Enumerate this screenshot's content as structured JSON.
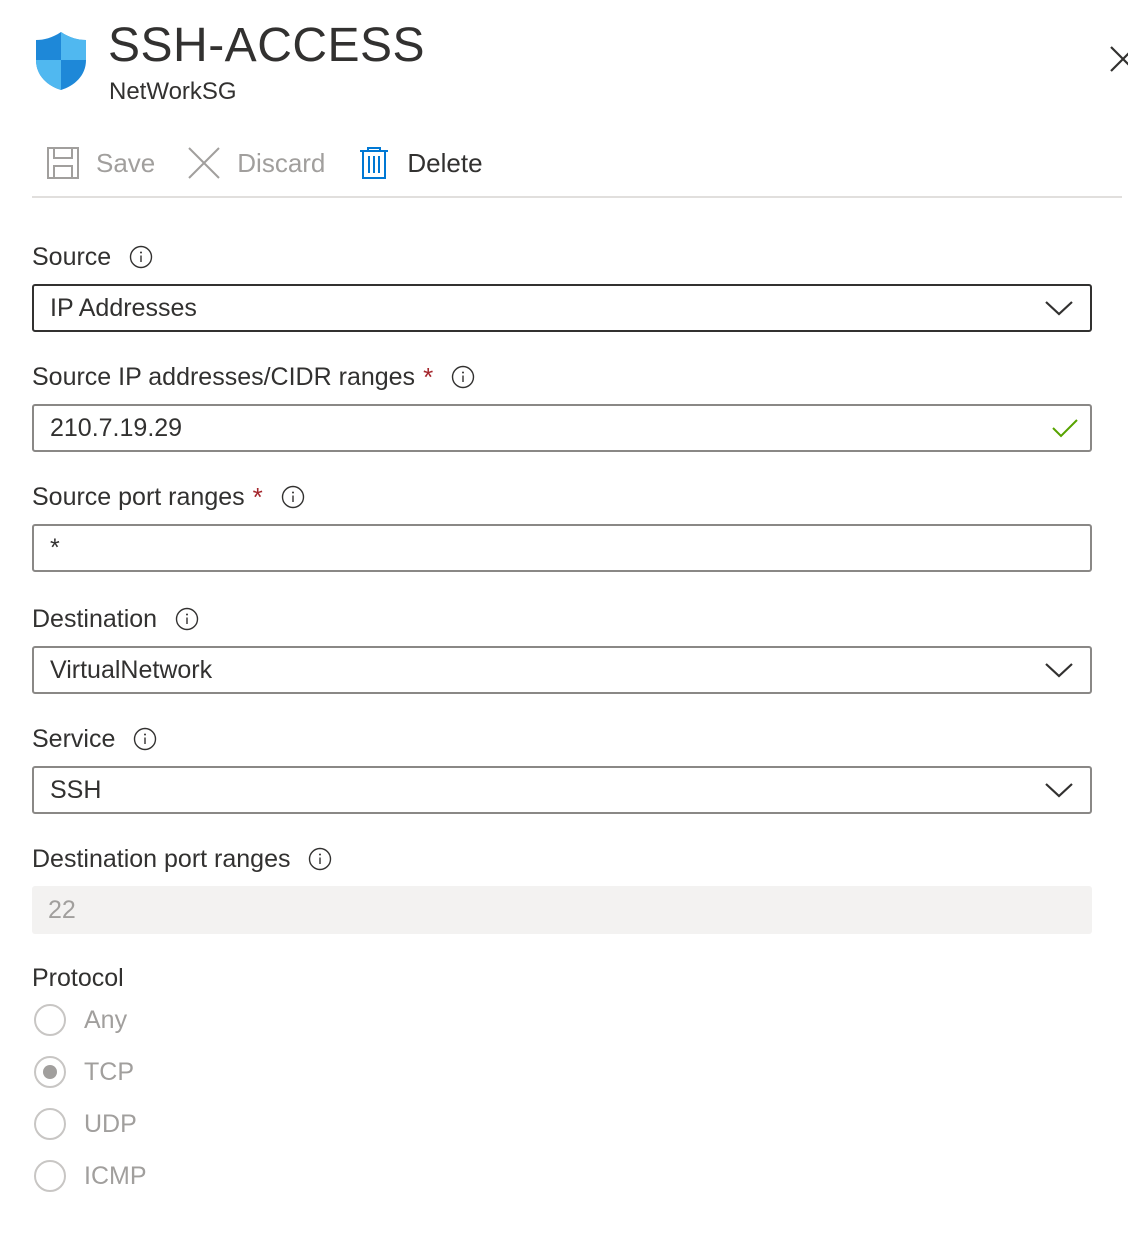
{
  "header": {
    "title": "SSH-ACCESS",
    "subtitle": "NetWorkSG"
  },
  "toolbar": {
    "save_label": "Save",
    "discard_label": "Discard",
    "delete_label": "Delete"
  },
  "form": {
    "source": {
      "label": "Source",
      "value": "IP Addresses"
    },
    "source_ip": {
      "label": "Source IP addresses/CIDR ranges",
      "required_mark": "*",
      "value": "210.7.19.29"
    },
    "source_port": {
      "label": "Source port ranges",
      "required_mark": "*",
      "value": "*"
    },
    "destination": {
      "label": "Destination",
      "value": "VirtualNetwork"
    },
    "service": {
      "label": "Service",
      "value": "SSH"
    },
    "dest_port": {
      "label": "Destination port ranges",
      "value": "22"
    },
    "protocol": {
      "label": "Protocol",
      "options": [
        "Any",
        "TCP",
        "UDP",
        "ICMP"
      ],
      "selected": "TCP"
    }
  },
  "colors": {
    "accent": "#0078d4",
    "required": "#a4262c",
    "valid": "#57a300",
    "disabled_text": "#a19f9d"
  }
}
